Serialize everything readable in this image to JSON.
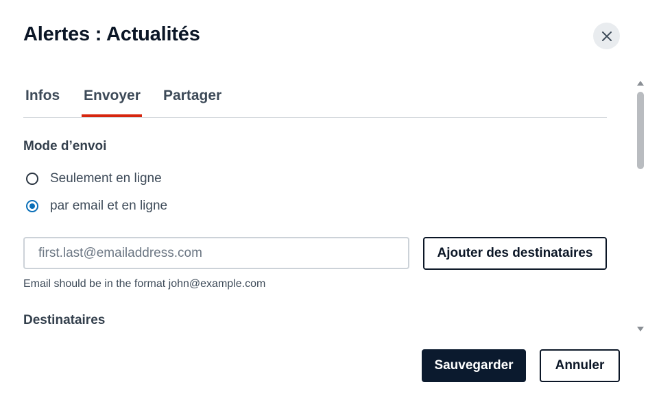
{
  "dialog": {
    "title": "Alertes : Actualités",
    "close_icon": "close-icon"
  },
  "tabs": [
    {
      "label": "Infos",
      "active": false
    },
    {
      "label": "Envoyer",
      "active": true
    },
    {
      "label": "Partager",
      "active": false
    }
  ],
  "colors": {
    "active_tab_underline": "#d6260f",
    "radio_selected": "#0a6fb8",
    "primary_button": "#0b1a2e"
  },
  "send_mode": {
    "label": "Mode d’envoi",
    "options": [
      {
        "label": "Seulement en ligne",
        "selected": false
      },
      {
        "label": "par email et en ligne",
        "selected": true
      }
    ]
  },
  "email": {
    "value": "",
    "placeholder": "first.last@emailaddress.com",
    "help_text": "Email should be in the format john@example.com",
    "add_button_label": "Ajouter des destinataires"
  },
  "recipients": {
    "label": "Destinataires"
  },
  "footer": {
    "save_label": "Sauvegarder",
    "cancel_label": "Annuler"
  }
}
